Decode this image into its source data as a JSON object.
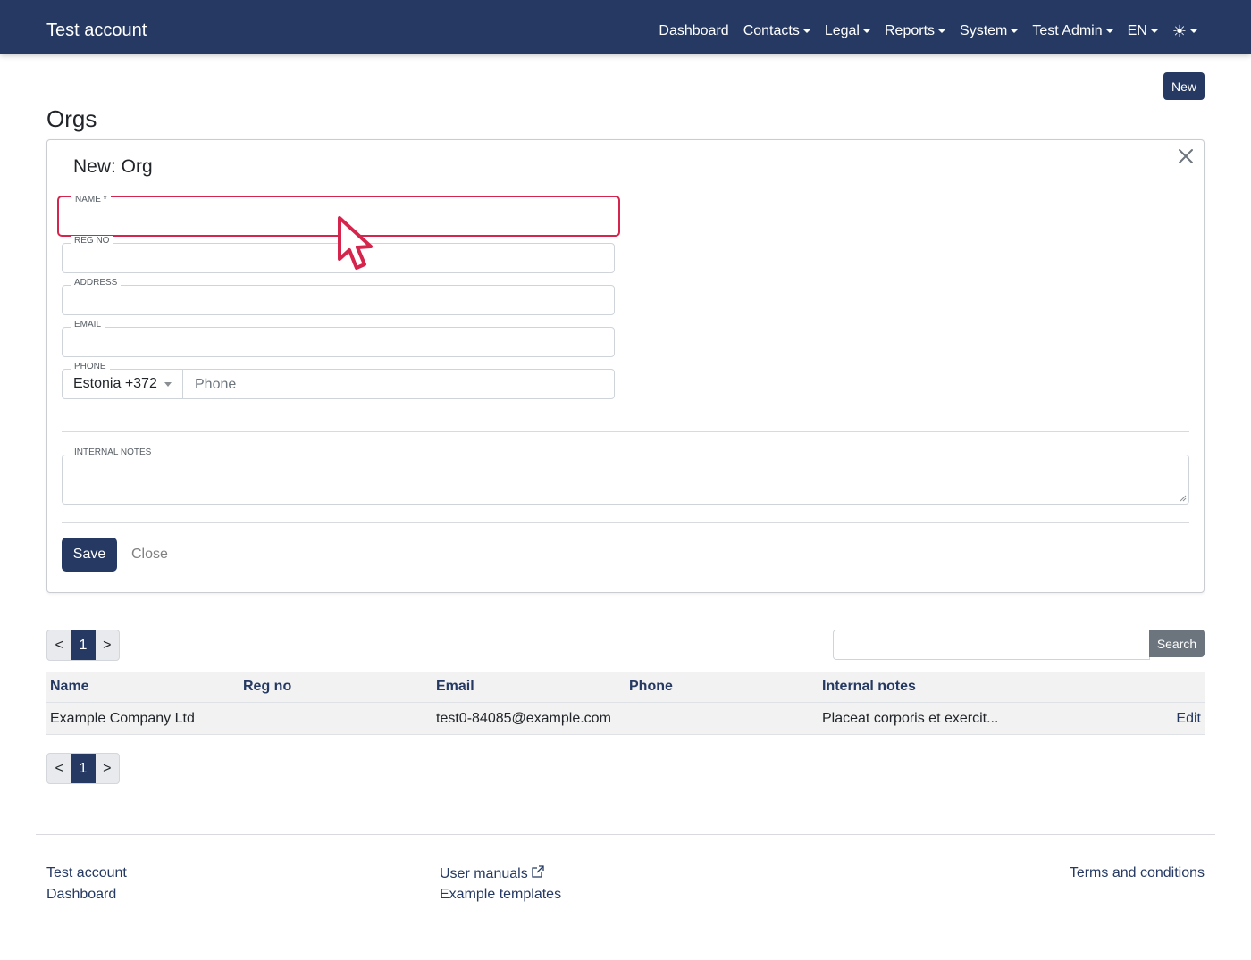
{
  "navbar": {
    "brand": "Test account",
    "items": [
      {
        "label": "Dashboard",
        "dropdown": false
      },
      {
        "label": "Contacts",
        "dropdown": true
      },
      {
        "label": "Legal",
        "dropdown": true
      },
      {
        "label": "Reports",
        "dropdown": true
      },
      {
        "label": "System",
        "dropdown": true
      },
      {
        "label": "Test Admin",
        "dropdown": true
      },
      {
        "label": "EN",
        "dropdown": true
      }
    ],
    "theme_icon": "sun-icon",
    "theme_glyph": "☀"
  },
  "page": {
    "title": "Orgs",
    "new_button": "New"
  },
  "form": {
    "title": "New: Org",
    "fields": {
      "name": {
        "label": "NAME *",
        "value": ""
      },
      "reg_no": {
        "label": "REG NO",
        "value": ""
      },
      "address": {
        "label": "ADDRESS",
        "value": ""
      },
      "email": {
        "label": "EMAIL",
        "value": ""
      },
      "phone": {
        "label": "PHONE",
        "country": "Estonia +372",
        "placeholder": "Phone",
        "value": ""
      },
      "internal_notes": {
        "label": "INTERNAL NOTES",
        "value": ""
      }
    },
    "save_button": "Save",
    "close_button": "Close"
  },
  "pagination": {
    "prev": "<",
    "current": "1",
    "next": ">"
  },
  "search": {
    "value": "",
    "button": "Search"
  },
  "table": {
    "columns": [
      "Name",
      "Reg no",
      "Email",
      "Phone",
      "Internal notes"
    ],
    "rows": [
      {
        "name": "Example Company Ltd",
        "reg_no": "",
        "email": "test0-84085@example.com",
        "phone": "",
        "internal_notes": "Placeat corporis et exercit...",
        "action": "Edit"
      }
    ]
  },
  "footer": {
    "col1": [
      "Test account",
      "Dashboard"
    ],
    "col2": [
      "User manuals",
      "Example templates"
    ],
    "col3": [
      "Terms and conditions"
    ]
  },
  "colors": {
    "primary": "#253962",
    "focus_highlight": "#d6254d",
    "secondary": "#6c757d"
  }
}
